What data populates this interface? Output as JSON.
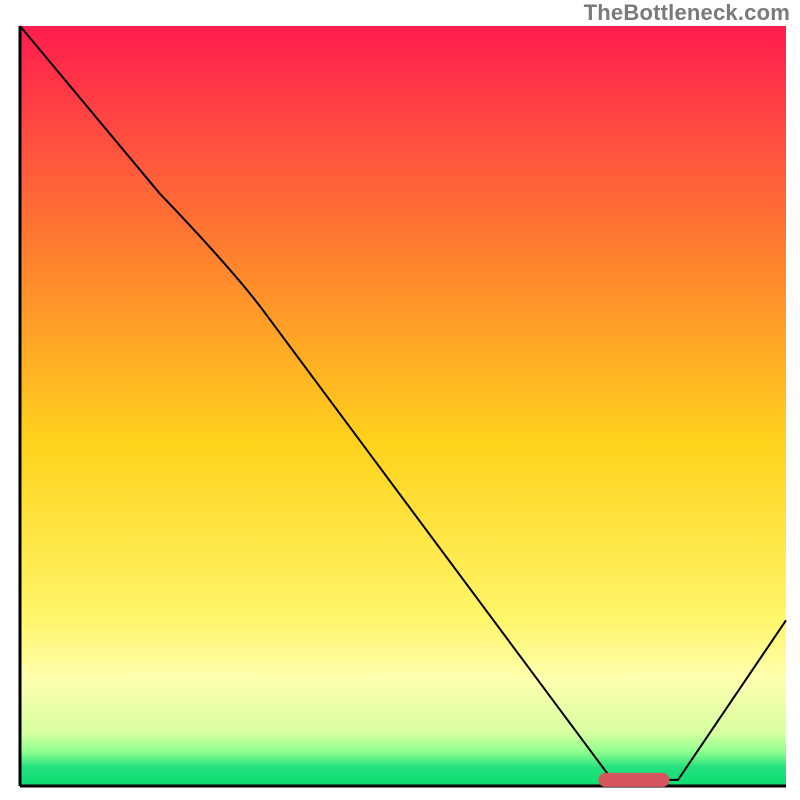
{
  "watermark": {
    "text": "TheBottleneck.com"
  },
  "chart_data": {
    "type": "line",
    "title": "",
    "xlabel": "",
    "ylabel": "",
    "xlim": [
      0,
      100
    ],
    "ylim": [
      0,
      100
    ],
    "legend": false,
    "grid": false,
    "background_gradient": {
      "stops": [
        {
          "offset": 0.0,
          "color": "#ff1c4f"
        },
        {
          "offset": 0.33,
          "color": "#ff8a2c"
        },
        {
          "offset": 0.55,
          "color": "#ffd31c"
        },
        {
          "offset": 0.78,
          "color": "#fff66a"
        },
        {
          "offset": 0.86,
          "color": "#ffffb0"
        },
        {
          "offset": 0.93,
          "color": "#d7ffa0"
        },
        {
          "offset": 0.955,
          "color": "#8eff8e"
        },
        {
          "offset": 0.975,
          "color": "#25e17e"
        },
        {
          "offset": 1.0,
          "color": "#0bdc70"
        }
      ]
    },
    "series": [
      {
        "name": "bottleneck-curve",
        "color": "#000000",
        "stroke_width": 2,
        "x": [
          0.0,
          18.2,
          27.7,
          77.3,
          85.9,
          100.0
        ],
        "y": [
          100.0,
          78.0,
          68.0,
          0.8,
          0.8,
          21.8
        ]
      }
    ],
    "marker": {
      "name": "optimal-range",
      "color": "#d6565e",
      "x_start": 75.5,
      "x_end": 84.8,
      "y": 0.8,
      "thickness_px": 14,
      "rx": 7
    }
  }
}
